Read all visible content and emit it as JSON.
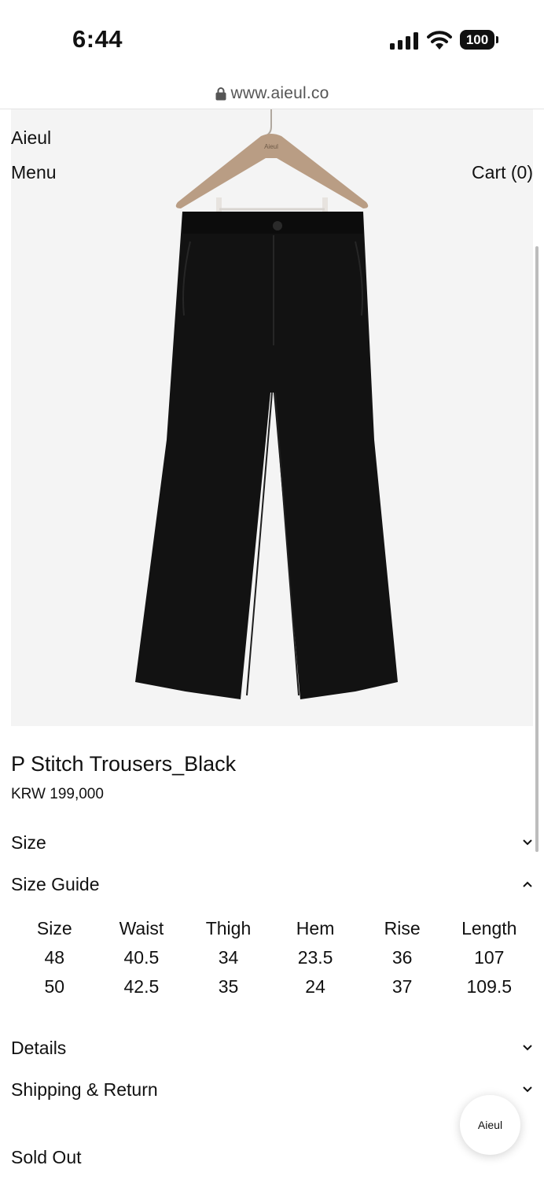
{
  "status_bar": {
    "time": "6:44",
    "battery": "100"
  },
  "url_bar": {
    "url": "www.aieul.co"
  },
  "header": {
    "brand": "Aieul",
    "menu": "Menu",
    "cart": "Cart (0)"
  },
  "product_image": {
    "hanger_brand": "Aieul"
  },
  "product": {
    "title": "P Stitch Trousers_Black",
    "price": "KRW 199,000"
  },
  "sections": {
    "size": "Size",
    "size_guide": "Size Guide",
    "details": "Details",
    "shipping_return": "Shipping & Return"
  },
  "size_guide_table": {
    "headers": [
      "Size",
      "Waist",
      "Thigh",
      "Hem",
      "Rise",
      "Length"
    ],
    "rows": [
      [
        "48",
        "40.5",
        "34",
        "23.5",
        "36",
        "107"
      ],
      [
        "50",
        "42.5",
        "35",
        "24",
        "37",
        "109.5"
      ]
    ]
  },
  "chat": {
    "label": "Aieul"
  },
  "purchase": {
    "status": "Sold Out"
  },
  "colors": {
    "text": "#111111",
    "image_bg": "#f4f4f4",
    "trousers": "#121212"
  },
  "icons": [
    "signal-icon",
    "wifi-icon",
    "battery-icon",
    "lock-icon",
    "chevron-down-icon",
    "chevron-up-icon"
  ]
}
